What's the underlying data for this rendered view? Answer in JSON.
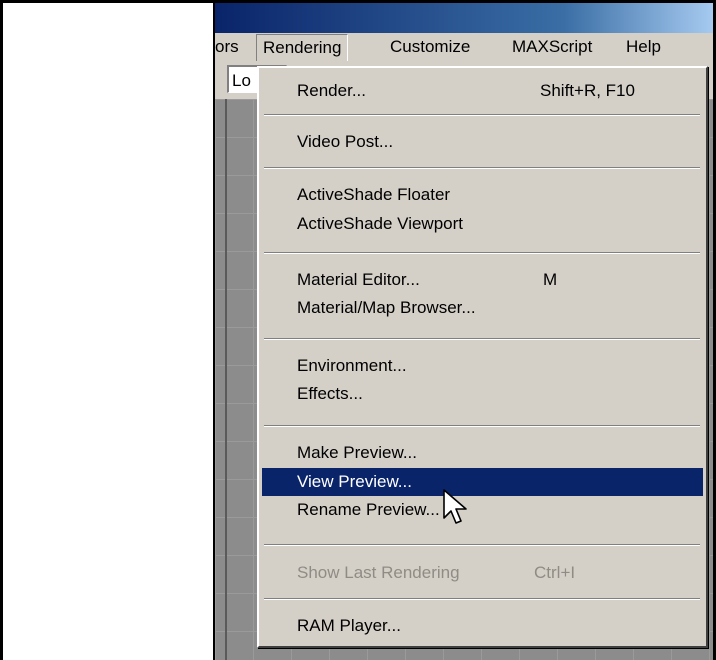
{
  "menubar": {
    "partial_left": "ors",
    "rendering": "Rendering",
    "customize": "Customize",
    "maxscript": "MAXScript",
    "help": "Help"
  },
  "toolbar": {
    "combo_value": "Lo"
  },
  "menu": {
    "render": {
      "label": "Render...",
      "shortcut": "Shift+R, F10"
    },
    "video_post": {
      "label": "Video Post..."
    },
    "activeshade_floater": {
      "label": "ActiveShade Floater"
    },
    "activeshade_viewport": {
      "label": "ActiveShade Viewport"
    },
    "material_editor": {
      "label": "Material Editor...",
      "shortcut": "M"
    },
    "material_map_browser": {
      "label": "Material/Map Browser..."
    },
    "environment": {
      "label": "Environment..."
    },
    "effects": {
      "label": "Effects..."
    },
    "make_preview": {
      "label": "Make Preview..."
    },
    "view_preview": {
      "label": "View Preview..."
    },
    "rename_preview": {
      "label": "Rename Preview..."
    },
    "show_last_rendering": {
      "label": "Show Last Rendering",
      "shortcut": "Ctrl+I"
    },
    "ram_player": {
      "label": "RAM Player..."
    }
  },
  "colors": {
    "highlight": "#0a246a",
    "menu_bg": "#d4d0c8",
    "title_start": "#0a246a"
  },
  "icons": {
    "cursor": "arrow-cursor-icon"
  }
}
